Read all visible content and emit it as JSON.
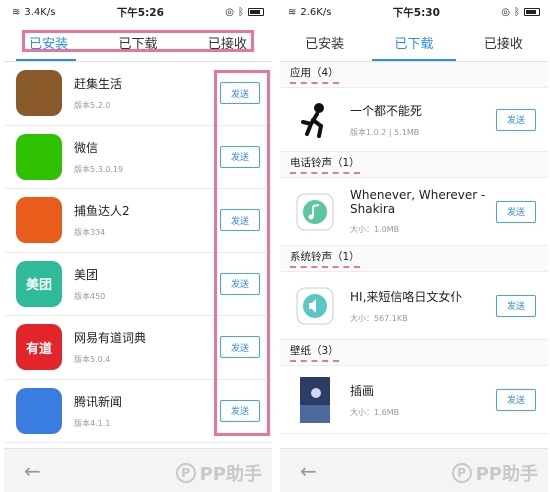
{
  "left": {
    "status": {
      "signal": "3.4K/s",
      "time": "下午5:26"
    },
    "tabs": [
      "已安装",
      "已下载",
      "已接收"
    ],
    "apps": [
      {
        "name": "赶集生活",
        "version": "版本5.2.0",
        "icon_text": "",
        "color": "#8b5a2b"
      },
      {
        "name": "微信",
        "version": "版本5.3.0.19",
        "icon_text": "",
        "color": "#2dc100"
      },
      {
        "name": "捕鱼达人2",
        "version": "版本334",
        "icon_text": "",
        "color": "#e85c1c"
      },
      {
        "name": "美团",
        "version": "版本450",
        "icon_text": "美团",
        "color": "#2fbb9a"
      },
      {
        "name": "网易有道词典",
        "version": "版本5.0.4",
        "icon_text": "有道",
        "color": "#e2242b"
      },
      {
        "name": "腾讯新闻",
        "version": "版本4.1.1",
        "icon_text": "",
        "color": "#3a7de0"
      }
    ],
    "send_label": "发送"
  },
  "right": {
    "status": {
      "signal": "2.6K/s",
      "time": "下午5:30"
    },
    "tabs": [
      "已安装",
      "已下载",
      "已接收"
    ],
    "sections": [
      {
        "title": "应用（4）",
        "items": [
          {
            "name": "一个都不能死",
            "meta": "版本1.0.2 | 5.1MB",
            "icon": "runner"
          }
        ]
      },
      {
        "title": "电话铃声（1）",
        "items": [
          {
            "name": "Whenever, Wherever - Shakira",
            "meta": "大小：1.0MB",
            "icon": "music"
          }
        ]
      },
      {
        "title": "系统铃声（1）",
        "items": [
          {
            "name": "HI,来短信咯日文女仆",
            "meta": "大小：567.1KB",
            "icon": "speaker"
          }
        ]
      },
      {
        "title": "壁纸（3）",
        "items": [
          {
            "name": "插画",
            "meta": "大小：1.6MB",
            "icon": "wallpaper"
          }
        ]
      }
    ],
    "send_label": "发送"
  },
  "watermark": "PP助手",
  "back_icon": "arrow-left-icon"
}
